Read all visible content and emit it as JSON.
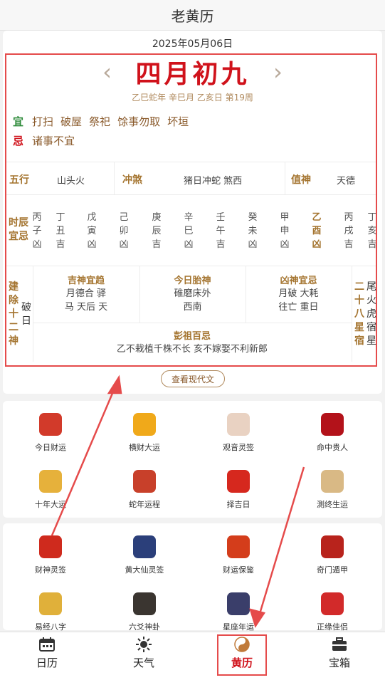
{
  "app": {
    "title": "老黄历"
  },
  "calendar": {
    "date": "2025年05月06日",
    "lunar": "四月初九",
    "ganzhi": "乙巳蛇年 辛巳月 乙亥日 第19周",
    "yi_label": "宜",
    "yi_items": [
      "打扫",
      "破屋",
      "祭祀",
      "馀事勿取",
      "坏垣"
    ],
    "ji_label": "忌",
    "ji_items": [
      "诸事不宜"
    ],
    "wuxing_label": "五行",
    "wuxing_value": "山头火",
    "chongsha_label": "冲煞",
    "chongsha_value": "猪日冲蛇 煞西",
    "zhishen_label": "值神",
    "zhishen_value": "天德",
    "shichen_label": "时辰宜忌",
    "hours": [
      {
        "gan": "丙",
        "zhi": "子",
        "luck": "凶"
      },
      {
        "gan": "丁",
        "zhi": "丑",
        "luck": "吉"
      },
      {
        "gan": "戊",
        "zhi": "寅",
        "luck": "凶"
      },
      {
        "gan": "己",
        "zhi": "卯",
        "luck": "凶"
      },
      {
        "gan": "庚",
        "zhi": "辰",
        "luck": "吉"
      },
      {
        "gan": "辛",
        "zhi": "巳",
        "luck": "凶"
      },
      {
        "gan": "壬",
        "zhi": "午",
        "luck": "吉"
      },
      {
        "gan": "癸",
        "zhi": "未",
        "luck": "凶"
      },
      {
        "gan": "甲",
        "zhi": "申",
        "luck": "凶"
      },
      {
        "gan": "乙",
        "zhi": "酉",
        "luck": "凶"
      },
      {
        "gan": "丙",
        "zhi": "戌",
        "luck": "吉"
      },
      {
        "gan": "丁",
        "zhi": "亥",
        "luck": "吉"
      }
    ],
    "jianchu_label": "建除十二神",
    "jianchu_value": "破日",
    "jishen_title": "吉神宜趋",
    "jishen_line1": "月德合 驿",
    "jishen_line2": "马 天后 天",
    "taishen_title": "今日胎神",
    "taishen_line1": "碓磨床外",
    "taishen_line2": "西南",
    "xiongshen_title": "凶神宜忌",
    "xiongshen_line1": "月破 大耗",
    "xiongshen_line2": "往亡 重日",
    "xiu_label": "二十八星宿",
    "xiu_value": "尾火虎宿星",
    "pengzu_title": "彭祖百忌",
    "pengzu_text": "乙不栽植千株不长 亥不嫁娶不利新郎",
    "modern_button": "查看现代文"
  },
  "grid1": [
    {
      "label": "今日财运",
      "icon": "caishen-icon",
      "color": "#d23a2a"
    },
    {
      "label": "横财大运",
      "icon": "gold-ingot-icon",
      "color": "#f0a91a"
    },
    {
      "label": "观音灵签",
      "icon": "guanyin-icon",
      "color": "#e9d2c2"
    },
    {
      "label": "命中贵人",
      "icon": "guiren-icon",
      "color": "#b3121a"
    },
    {
      "label": "十年大运",
      "icon": "bagua-coin-icon",
      "color": "#e6b13b"
    },
    {
      "label": "蛇年运程",
      "icon": "snake-year-icon",
      "color": "#c8402a"
    },
    {
      "label": "择吉日",
      "icon": "ji-scroll-icon",
      "color": "#d6281e"
    },
    {
      "label": "測终生运",
      "icon": "lifetime-fortune-icon",
      "color": "#d9b985"
    }
  ],
  "grid2": [
    {
      "label": "财神灵签",
      "icon": "caishen-lot-icon",
      "color": "#cf2a1d"
    },
    {
      "label": "黄大仙灵签",
      "icon": "huangdaxian-icon",
      "color": "#2b3f7a"
    },
    {
      "label": "财运保鉴",
      "icon": "wealth-book-icon",
      "color": "#d43d1b"
    },
    {
      "label": "奇门遁甲",
      "icon": "qimen-icon",
      "color": "#b8231c"
    },
    {
      "label": "易经八字",
      "icon": "yijing-icon",
      "color": "#e0b03a"
    },
    {
      "label": "六爻神卦",
      "icon": "liuyao-icon",
      "color": "#3a3530"
    },
    {
      "label": "星座年运",
      "icon": "zodiac-icon",
      "color": "#3a3e6a"
    },
    {
      "label": "正缘佳侣",
      "icon": "couple-icon",
      "color": "#d22a2a"
    }
  ],
  "tabs": [
    {
      "label": "日历",
      "icon": "calendar-icon"
    },
    {
      "label": "天气",
      "icon": "weather-icon"
    },
    {
      "label": "黄历",
      "icon": "yinyang-icon"
    },
    {
      "label": "宝箱",
      "icon": "toolbox-icon"
    }
  ],
  "colors": {
    "red": "#d0121b",
    "gold": "#a4742f",
    "annotation": "#e54b4b"
  }
}
